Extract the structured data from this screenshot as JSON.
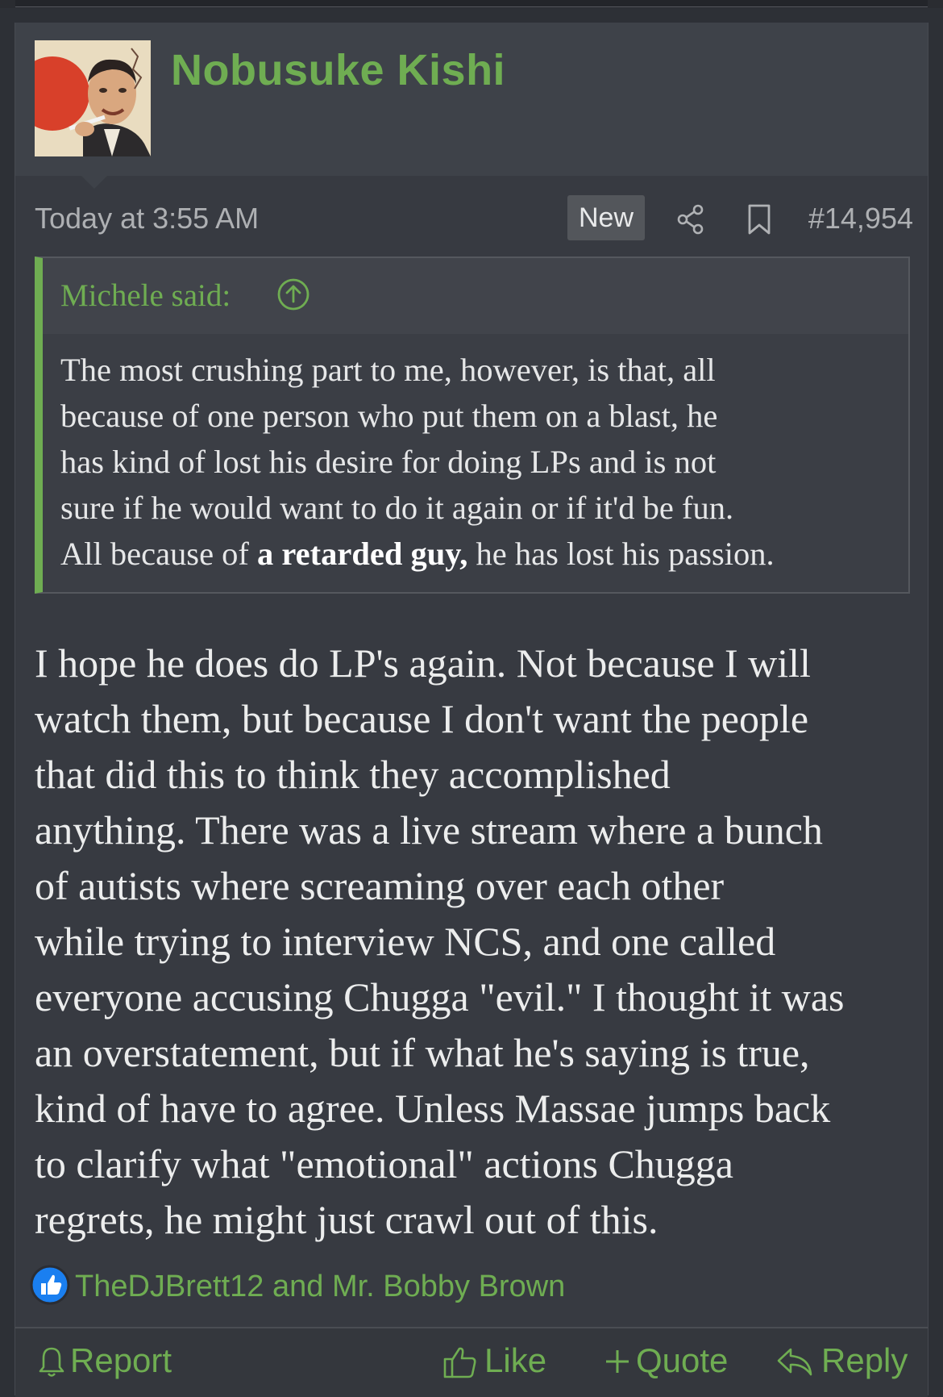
{
  "post": {
    "username": "Nobusuke Kishi",
    "timestamp": "Today at 3:55 AM",
    "badge": "New",
    "post_number": "#14,954",
    "quote": {
      "author_label": "Michele said:",
      "lines": [
        "The most crushing part to me, however, is that, all",
        "because of one person who put them on a blast, he",
        "has kind of lost his desire for doing LPs and is not",
        "sure if he would want to do it again or if it'd be fun."
      ],
      "last_line_prefix": "All because of ",
      "last_line_bold": "a retarded guy,",
      "last_line_suffix": " he has lost his passion."
    },
    "message_lines": [
      "I hope he does do LP's again. Not because I will",
      "watch them, but because I don't want the people",
      "that did this to think they accomplished",
      "anything. There was a live stream where a bunch",
      "of autists where screaming over each other",
      "while trying to interview NCS, and one called",
      "everyone accusing Chugga \"evil.\" I thought it was",
      "an overstatement, but if what he's saying is true,",
      "kind of have to agree. Unless Massae jumps back",
      "to clarify what \"emotional\" actions Chugga",
      "regrets, he might just crawl out of this."
    ],
    "reactions": {
      "users": "TheDJBrett12 and Mr. Bobby Brown"
    },
    "footer": {
      "report": "Report",
      "like": "Like",
      "quote": "Quote",
      "reply": "Reply"
    }
  },
  "colors": {
    "accent_green": "#6fad52",
    "background": "#2d3036",
    "post_background": "#373a41",
    "like_blue": "#1a7ff0"
  },
  "icons": [
    "share-icon",
    "bookmark-icon",
    "arrow-up-circle-icon",
    "thumbs-up-icon",
    "bell-icon",
    "plus-icon",
    "reply-icon"
  ]
}
